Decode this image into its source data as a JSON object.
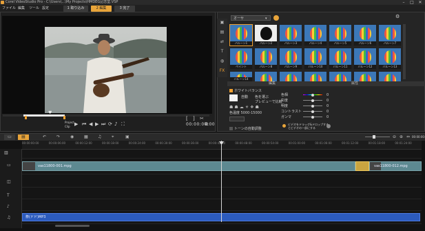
{
  "window": {
    "title": "Corel VideoStudio Pro - C:\\Users\\...\\My Projects\\HMDEG記念堂.VSP"
  },
  "menu": {
    "items": [
      "ファイル",
      "編集",
      "ツール",
      "設定"
    ]
  },
  "steps": {
    "capture": "1 取り込み",
    "edit": "2 編集",
    "share": "3 完了"
  },
  "preview": {
    "timecode": "00:00:00:00",
    "project_label": "Project",
    "clip_label": "Clip"
  },
  "library": {
    "category": "オーサ",
    "thumbs": [
      {
        "label": "バルーン1"
      },
      {
        "label": "バルーン2"
      },
      {
        "label": "バルーン3"
      },
      {
        "label": "バルーン4"
      },
      {
        "label": "バルーン5"
      },
      {
        "label": "バルーン6"
      },
      {
        "label": "バルーン7"
      },
      {
        "label": "ペイント"
      },
      {
        "label": "バルーン8"
      },
      {
        "label": "バルーン9"
      },
      {
        "label": "バルーン10"
      },
      {
        "label": "バルーン11"
      },
      {
        "label": "バルーン12"
      },
      {
        "label": "バルーン13"
      },
      {
        "label": "バルーン14"
      },
      {
        "label": ""
      },
      {
        "label": ""
      },
      {
        "label": ""
      },
      {
        "label": ""
      },
      {
        "label": ""
      },
      {
        "label": ""
      }
    ],
    "tab_edit": "編集",
    "tab_attr": "属性"
  },
  "edit_panel": {
    "white_balance": "ホワイトバランス",
    "auto": "自動",
    "pick_color": "色を選ぶ",
    "preview_compare": "プレビューで比較",
    "color_temp": "色温度 5000-15000",
    "auto_tone": "トーンの自動調整",
    "sliders": [
      {
        "label": "色相",
        "value": "0"
      },
      {
        "label": "彩度",
        "value": "0"
      },
      {
        "label": "明度",
        "value": "0"
      },
      {
        "label": "コントラスト",
        "value": "0"
      },
      {
        "label": "ガンマ",
        "value": "0"
      }
    ],
    "apply_note": "ビデオをドラッグ&ドロップするとビデオの一部にする"
  },
  "timeline": {
    "ticks": [
      "00:00:00:00",
      "00:00:06:00",
      "00:00:12:00",
      "00:00:18:00",
      "00:00:24:00",
      "00:00:30:00",
      "00:00:36:00",
      "00:00:42:00",
      "00:00:48:00",
      "00:00:54:00",
      "00:01:00:00",
      "00:01:06:00",
      "00:01:12:00",
      "00:01:18:00",
      "00:01:24:00"
    ],
    "clip1": "vas11800-001.mpg",
    "clip2": "vas11800-012.mpg",
    "music": "祭(ドド)MP3"
  }
}
